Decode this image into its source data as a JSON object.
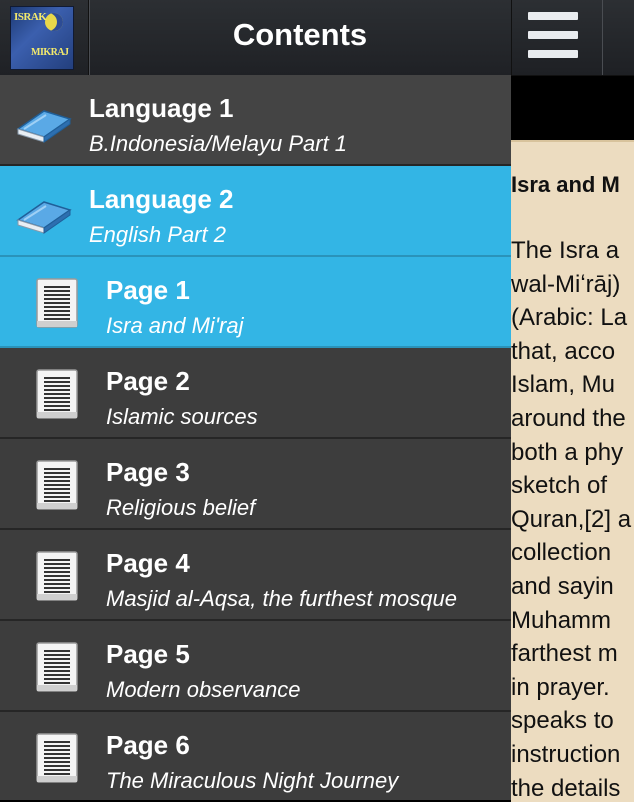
{
  "drawer": {
    "title": "Contents",
    "logo_text": [
      "ISRAK",
      "MIKRAJ"
    ],
    "items": [
      {
        "kind": "language",
        "title": "Language 1",
        "subtitle": "B.Indonesia/Melayu Part 1",
        "icon": "book-icon",
        "active": false
      },
      {
        "kind": "language",
        "title": "Language 2",
        "subtitle": "English Part 2",
        "icon": "book-icon",
        "active": true
      },
      {
        "kind": "page",
        "title": "Page 1",
        "subtitle": "Isra and Mi'raj",
        "icon": "document-icon",
        "active": true
      },
      {
        "kind": "page",
        "title": "Page 2",
        "subtitle": "Islamic sources",
        "icon": "document-icon",
        "active": false
      },
      {
        "kind": "page",
        "title": "Page 3",
        "subtitle": "Religious belief",
        "icon": "document-icon",
        "active": false
      },
      {
        "kind": "page",
        "title": "Page 4",
        "subtitle": "Masjid al-Aqsa, the furthest mosque",
        "icon": "document-icon",
        "active": false
      },
      {
        "kind": "page",
        "title": "Page 5",
        "subtitle": "Modern observance",
        "icon": "document-icon",
        "active": false
      },
      {
        "kind": "page",
        "title": "Page 6",
        "subtitle": "The Miraculous Night Journey",
        "icon": "document-icon",
        "active": false
      }
    ]
  },
  "content": {
    "menu_icon": "hamburger-menu-icon",
    "article_title": "Isra and M",
    "article_lines": [
      "The Isra a",
      "wal-Miʻrāj)",
      "(Arabic: La",
      "that, acco",
      "Islam, Mu",
      "around the",
      "both a phy",
      "sketch of",
      "Quran,[2] a",
      "collection",
      "and sayin",
      "Muhamm",
      "farthest m",
      "in prayer.",
      "speaks to",
      "instruction",
      "the details"
    ]
  },
  "colors": {
    "accent": "#33b5e5",
    "drawer_bg": "#3c3c3c",
    "header_bg": "#2c2f33",
    "article_bg": "#ecdcc0"
  }
}
